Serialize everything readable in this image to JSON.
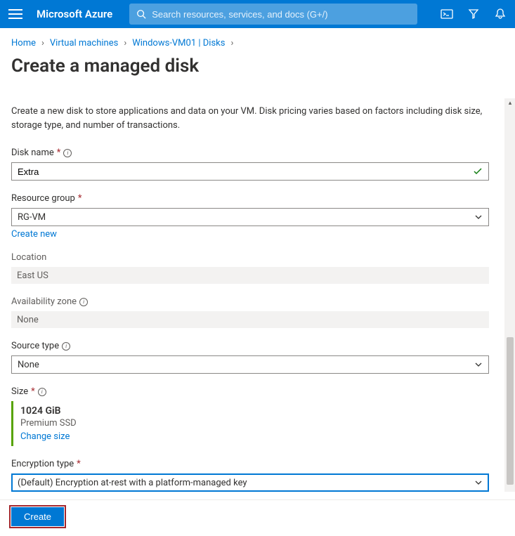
{
  "header": {
    "brand": "Microsoft Azure",
    "search_placeholder": "Search resources, services, and docs (G+/)"
  },
  "breadcrumb": {
    "items": [
      "Home",
      "Virtual machines",
      "Windows-VM01 | Disks"
    ]
  },
  "page": {
    "title": "Create a managed disk",
    "description": "Create a new disk to store applications and data on your VM. Disk pricing varies based on factors including disk size, storage type, and number of transactions."
  },
  "form": {
    "disk_name": {
      "label": "Disk name",
      "value": "Extra"
    },
    "resource_group": {
      "label": "Resource group",
      "value": "RG-VM",
      "create_new": "Create new"
    },
    "location": {
      "label": "Location",
      "value": "East US"
    },
    "availability_zone": {
      "label": "Availability zone",
      "value": "None"
    },
    "source_type": {
      "label": "Source type",
      "value": "None"
    },
    "size": {
      "label": "Size",
      "value": "1024 GiB",
      "tier": "Premium SSD",
      "change": "Change size"
    },
    "encryption_type": {
      "label": "Encryption type",
      "value": "(Default) Encryption at-rest with a platform-managed key"
    }
  },
  "actions": {
    "create": "Create"
  }
}
